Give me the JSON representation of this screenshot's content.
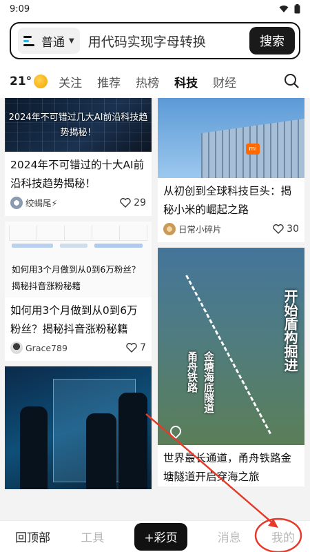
{
  "status_bar": {
    "time": "9:09"
  },
  "search": {
    "mode": "普通",
    "query": "用代码实现字母转换",
    "button": "搜索"
  },
  "weather": {
    "temp": "21°"
  },
  "tabs": [
    "关注",
    "推荐",
    "热榜",
    "科技",
    "财经"
  ],
  "active_tab": "科技",
  "feed": {
    "left": [
      {
        "thumb_text": "2024年不可错过几大AI前沿科技趋势揭秘！",
        "title": "2024年不可错过的十大AI前沿科技趋势揭秘！",
        "author": "绞蝎尾⚡",
        "likes": "29"
      },
      {
        "thumb_text": "如何用3个月做到从0到6万粉丝？揭秘抖音涨粉秘籍",
        "title": "如何用3个月做到从0到6万粉丝？揭秘抖音涨粉秘籍",
        "author": "Grace789",
        "likes": "7"
      }
    ],
    "right": [
      {
        "logo": "mi",
        "title": "从初创到全球科技巨头：揭秘小米的崛起之路",
        "author": "日常小碎片",
        "likes": "30"
      },
      {
        "thumb_big": "开始盾构掘进",
        "thumb_v1": "甬舟铁路",
        "thumb_v2": "金塘海底隧道",
        "title": "世界最长通道，甬舟铁路金塘隧道开启穿海之旅"
      }
    ]
  },
  "bottom_nav": {
    "top": "回顶部",
    "tools": "工具",
    "fab": "+彩页",
    "messages": "消息",
    "me": "我的"
  },
  "annotation_color": "#e53a2a"
}
